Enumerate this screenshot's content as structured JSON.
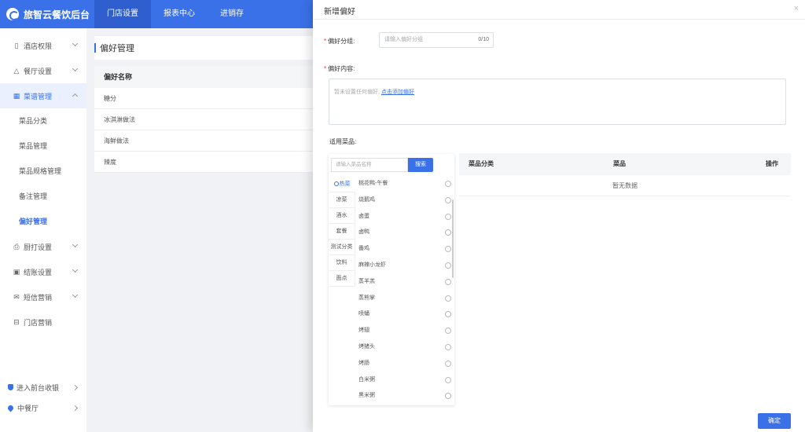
{
  "app": {
    "name": "旅智云餐饮后台"
  },
  "top_nav": [
    "门店设置",
    "报表中心",
    "进销存"
  ],
  "sidebar": {
    "items": [
      {
        "label": "酒店权限",
        "icon": "building-icon"
      },
      {
        "label": "餐厅设置",
        "icon": "bell-icon"
      },
      {
        "label": "菜谱管理",
        "icon": "grid-icon"
      }
    ],
    "sub_items": [
      "菜品分类",
      "菜品管理",
      "菜品规格管理",
      "备注管理",
      "偏好管理"
    ],
    "more_items": [
      {
        "label": "厨打设置",
        "icon": "printer-icon"
      },
      {
        "label": "结账设置",
        "icon": "bill-icon"
      },
      {
        "label": "短信营销",
        "icon": "mail-icon"
      },
      {
        "label": "门店营销",
        "icon": "gift-icon"
      }
    ],
    "bottom": [
      {
        "label": "进入前台收银",
        "icon": "shield-icon"
      },
      {
        "label": "中餐厅",
        "icon": "location-icon"
      }
    ]
  },
  "main": {
    "title": "偏好管理",
    "table_header": "偏好名称",
    "rows": [
      "糖分",
      "冰淇淋做法",
      "海鲜做法",
      "辣度"
    ]
  },
  "drawer": {
    "title": "新增偏好",
    "close": "×",
    "group_label": "偏好分组:",
    "group_placeholder": "请输入偏好分组",
    "group_count": "0/10",
    "content_label": "偏好内容:",
    "content_empty": "暂未设置任何偏好,",
    "content_link": "点击添加偏好",
    "dishes_label": "适用菜品:",
    "search_placeholder": "请输入菜品名称",
    "search_button": "搜索",
    "categories": [
      "热菜",
      "凉菜",
      "酒水",
      "套餐",
      "测试分类",
      "饮料",
      "面点"
    ],
    "dishes": [
      "桃花鸭-午餐",
      "烧鹅鸡",
      "卤蛋",
      "卤鸭",
      "番鸡",
      "麻辣小龙虾",
      "蒸羊羔",
      "蒸熊掌",
      "喷蛹",
      "烤翅",
      "烤猪头",
      "烤肠",
      "白米粥",
      "黑米粥"
    ],
    "table_headers": {
      "category": "菜品分类",
      "dish": "菜品",
      "action": "操作"
    },
    "empty_text": "暂无数据",
    "confirm": "确定"
  }
}
